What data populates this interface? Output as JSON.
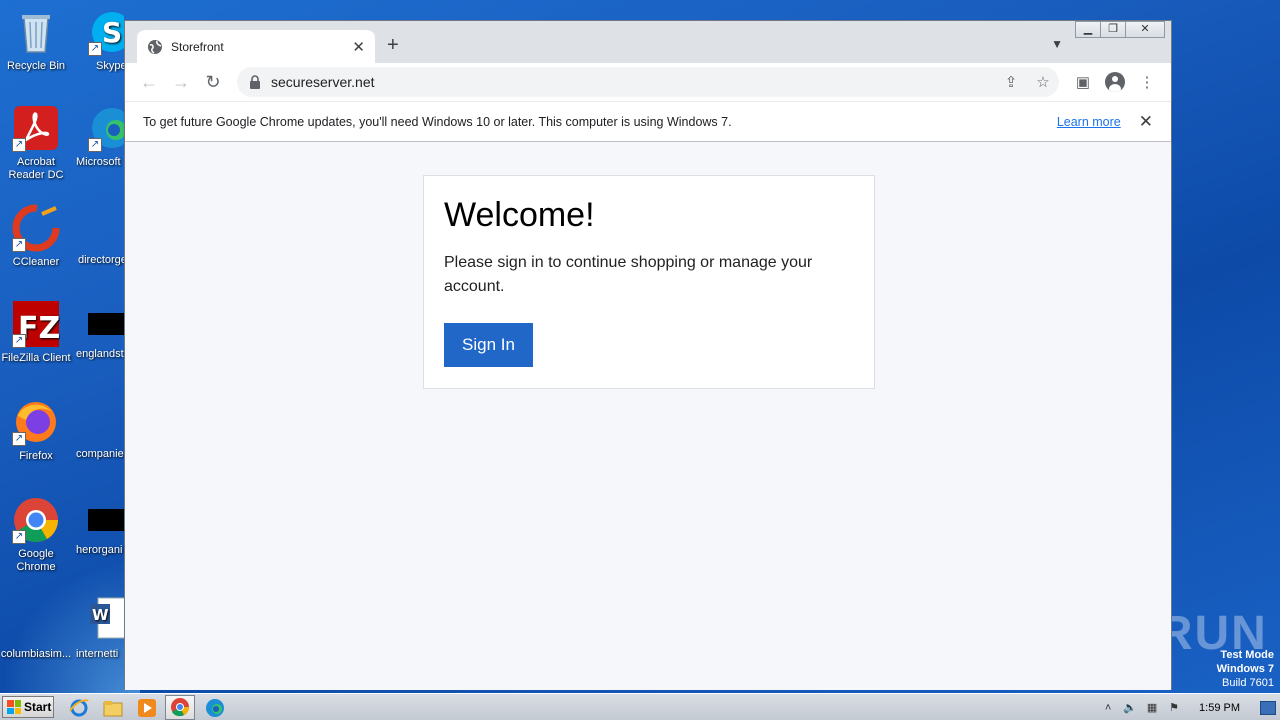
{
  "desktop": {
    "icons_col1": [
      {
        "label": "Recycle Bin",
        "icon": "recycle-bin-icon"
      },
      {
        "label": "Acrobat Reader DC",
        "icon": "acrobat-icon"
      },
      {
        "label": "CCleaner",
        "icon": "ccleaner-icon"
      },
      {
        "label": "FileZilla Client",
        "icon": "filezilla-icon"
      },
      {
        "label": "Firefox",
        "icon": "firefox-icon"
      },
      {
        "label": "Google Chrome",
        "icon": "chrome-icon"
      },
      {
        "label": "columbiasim...",
        "icon": "blank-file-icon"
      }
    ],
    "icons_col2": [
      {
        "label": "Skype",
        "icon": "skype-icon"
      },
      {
        "label": "Microsoft",
        "icon": "edge-icon"
      },
      {
        "label": "directorge",
        "icon": "blank-file-icon"
      },
      {
        "label": "englandst",
        "icon": "black-file-icon"
      },
      {
        "label": "companies",
        "icon": "blank-file-icon"
      },
      {
        "label": "herorgani",
        "icon": "black-file-icon"
      },
      {
        "label": "internetti",
        "icon": "word-doc-icon"
      }
    ],
    "watermark": "ANY RUN",
    "test_mode": {
      "line1": "Test Mode",
      "line2": "Windows 7",
      "line3": "Build 7601"
    }
  },
  "browser": {
    "tab": {
      "title": "Storefront",
      "favicon": "globe-icon"
    },
    "url": "secureserver.net",
    "infobar": {
      "message": "To get future Google Chrome updates, you'll need Windows 10 or later. This computer is using Windows 7.",
      "link": "Learn more"
    },
    "page": {
      "heading": "Welcome!",
      "text": "Please sign in to continue shopping or manage your account.",
      "button": "Sign In"
    }
  },
  "taskbar": {
    "start_label": "Start",
    "clock": "1:59 PM",
    "apps": [
      "ie-icon",
      "explorer-icon",
      "media-player-icon",
      "chrome-icon",
      "edge-icon"
    ]
  },
  "colors": {
    "accent_button": "#2067c7",
    "desktop_blue": "#1a5fc0",
    "link_blue": "#1a73e8"
  }
}
